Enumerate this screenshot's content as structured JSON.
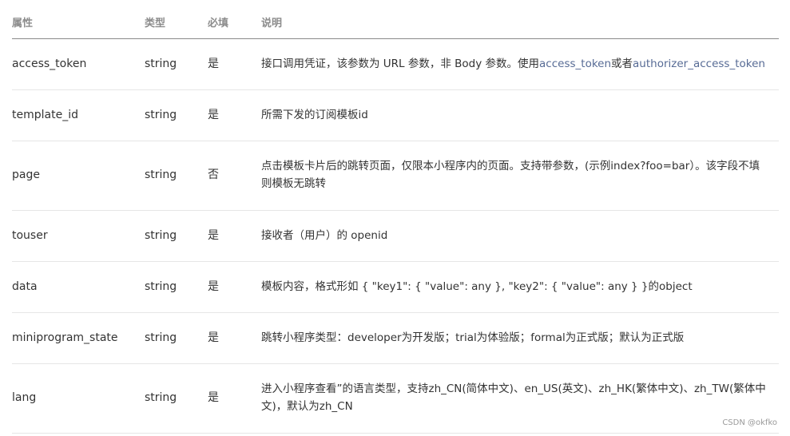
{
  "header": {
    "name": "属性",
    "type": "类型",
    "required": "必填",
    "desc": "说明"
  },
  "rows": [
    {
      "name": "access_token",
      "type": "string",
      "required": "是",
      "desc_prefix": "接口调用凭证，该参数为 URL 参数，非 Body 参数。使用",
      "link1": "access_token",
      "desc_mid": "或者",
      "link2": "authorizer_access_token"
    },
    {
      "name": "template_id",
      "type": "string",
      "required": "是",
      "desc": "所需下发的订阅模板id"
    },
    {
      "name": "page",
      "type": "string",
      "required": "否",
      "desc_line1": "点击模板卡片后的跳转页面，仅限本小程序内的页面。支持带参数，(示例index?foo=bar）。该字段不填",
      "desc_line2": "则模板无跳转"
    },
    {
      "name": "touser",
      "type": "string",
      "required": "是",
      "desc": "接收者（用户）的 openid"
    },
    {
      "name": "data",
      "type": "string",
      "required": "是",
      "desc": "模板内容，格式形如 { \"key1\": { \"value\": any }, \"key2\": { \"value\": any } }的object"
    },
    {
      "name": "miniprogram_state",
      "type": "string",
      "required": "是",
      "desc": "跳转小程序类型：developer为开发版；trial为体验版；formal为正式版；默认为正式版"
    },
    {
      "name": "lang",
      "type": "string",
      "required": "是",
      "desc_line1": "进入小程序查看”的语言类型，支持zh_CN(简体中文)、en_US(英文)、zh_HK(繁体中文)、zh_TW(繁体中",
      "desc_line2": "文)，默认为zh_CN"
    }
  ],
  "watermark": "CSDN @okfko"
}
